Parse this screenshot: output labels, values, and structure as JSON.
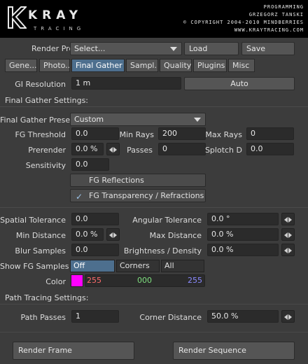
{
  "header": {
    "logo_text": "KRAY",
    "logo_sub": "TRACING",
    "lines": [
      "PROGRAMMING",
      "GRZEGORZ TANSKI",
      "© COPYRIGHT 2004-2010 MINDBERRIES",
      "WWW.KRAYTRACING.COM"
    ]
  },
  "preset": {
    "label": "Render Preset",
    "value": "Select...",
    "load": "Load",
    "save": "Save"
  },
  "tabs": [
    "Gene...",
    "Photo...",
    "Final Gather",
    "Sampl...",
    "Quality",
    "Plugins",
    "Misc"
  ],
  "active_tab": "Final Gather",
  "gi": {
    "label": "GI Resolution",
    "value": "1 m",
    "auto": "Auto"
  },
  "fg_section": "Final Gather Settings:",
  "fg": {
    "preset_label": "Final Gather Preset",
    "preset_value": "Custom",
    "threshold_label": "FG Threshold",
    "threshold": "0.0",
    "minrays_label": "Min Rays",
    "minrays": "200",
    "maxrays_label": "Max Rays",
    "maxrays": "0",
    "prerender_label": "Prerender",
    "prerender": "0.0 %",
    "passes_label": "Passes",
    "passes": "0",
    "splotch_label": "Splotch D",
    "splotch": "0.0",
    "sensitivity_label": "Sensitivity",
    "sensitivity": "0.0",
    "reflections_label": "FG Reflections",
    "reflections_checked": false,
    "transparency_label": "FG Transparency / Refractions",
    "transparency_checked": true
  },
  "tol": {
    "spatial_label": "Spatial Tolerance",
    "spatial": "0.0",
    "angular_label": "Angular Tolerance",
    "angular": "0.0 °",
    "mindist_label": "Min Distance",
    "mindist": "0.0 %",
    "maxdist_label": "Max Distance",
    "maxdist": "0.0 %",
    "blur_label": "Blur Samples",
    "blur": "0.0",
    "bright_label": "Brightness / Density",
    "bright": "0.0 %"
  },
  "show": {
    "label": "Show FG Samples",
    "options": [
      "Off",
      "Corners",
      "All"
    ],
    "selected": "Off"
  },
  "color": {
    "label": "Color",
    "swatch": "#ff00ff",
    "r": "255",
    "g": "000",
    "b": "255",
    "r_color": "#ff6b6b",
    "g_color": "#7fe07f",
    "b_color": "#8a8aff"
  },
  "path_section": "Path Tracing Settings:",
  "path": {
    "passes_label": "Path Passes",
    "passes": "1",
    "corner_label": "Corner Distance",
    "corner": "50.0 %"
  },
  "actions": {
    "render_frame": "Render Frame",
    "render_sequence": "Render Sequence"
  }
}
